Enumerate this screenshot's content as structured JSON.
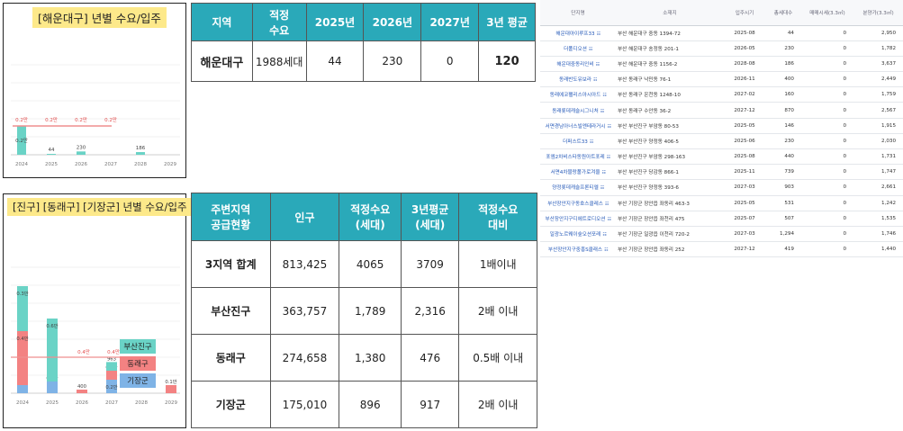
{
  "haeundae_panel": {
    "title": "[해운대구] 년별 수요/입주",
    "chart_data": {
      "type": "bar",
      "categories": [
        "2024",
        "2025",
        "2026",
        "2027",
        "2028",
        "2029"
      ],
      "series": [
        {
          "values": [
            0.2,
            0.0044,
            0.023,
            0,
            0.0186,
            0
          ],
          "labels": [
            "0.2만",
            "44",
            "230",
            "",
            "186",
            ""
          ]
        }
      ],
      "demand_line": {
        "value": 0.2,
        "labels": [
          "0.2만",
          "0.2만",
          "0.2만",
          "0.2만"
        ]
      },
      "colors": {
        "bar": "#6ad3c6",
        "line": "#ef8f8f",
        "label": "#e34c4c"
      }
    }
  },
  "haeundae_table": {
    "headers": [
      "지역",
      "적정\n수요",
      "2025년",
      "2026년",
      "2027년",
      "3년 평균"
    ],
    "row": [
      "해운대구",
      "1988세대",
      "44",
      "230",
      "0",
      "120"
    ]
  },
  "east_panel": {
    "title": "[진구] [동래구] [기장군] 년별 수요/입주",
    "chart_data": {
      "type": "bar",
      "categories": [
        "2024",
        "2025",
        "2026",
        "2027",
        "2028",
        "2029"
      ],
      "series": [
        {
          "name": "부산진구",
          "values": [
            0.5,
            0.7,
            0,
            0.0963,
            0,
            0
          ],
          "labels": [
            "0.3만",
            "0.6만",
            "",
            "963",
            "",
            ""
          ]
        },
        {
          "name": "동래구",
          "values": [
            0.6,
            0,
            0.04,
            0.1,
            0,
            0.09
          ],
          "labels": [
            "0.4만",
            "",
            "400",
            "0.1만",
            "",
            "0.1만"
          ]
        },
        {
          "name": "기장군",
          "values": [
            0.09,
            0.13,
            0,
            0.15,
            0,
            0
          ],
          "labels": [
            "371",
            "0.1만",
            "",
            "0.2만",
            "",
            ""
          ]
        }
      ],
      "demand_line": {
        "value": 0.4,
        "labels": [
          "0.4만",
          "0.4만"
        ]
      },
      "legend": [
        "부산진구",
        "동래구",
        "기장군"
      ],
      "colors": {
        "부산진구": "#6ad3c6",
        "동래구": "#f38282",
        "기장군": "#7fb3e6"
      }
    }
  },
  "supply_table": {
    "headers": [
      "주변지역\n공급현황",
      "인구",
      "적정수요\n(세대)",
      "3년평균\n(세대)",
      "적정수요\n대비"
    ],
    "rows": [
      [
        "3지역 합계",
        "813,425",
        "4065",
        "3709",
        "1배이내"
      ],
      [
        "부산진구",
        "363,757",
        "1,789",
        "2,316",
        "2배 이내"
      ],
      [
        "동래구",
        "274,658",
        "1,380",
        "476",
        "0.5배 이내"
      ],
      [
        "기장군",
        "175,010",
        "896",
        "917",
        "2배 이내"
      ]
    ]
  },
  "listing_table": {
    "headers": [
      "단지명",
      "소재지",
      "입주시기",
      "총세대수",
      "매매시세(3.3㎡)",
      "분양가(3.3㎡)"
    ],
    "rows": [
      [
        "해운대아이루프33",
        "부산 해운대구 중동 1394-72",
        "2025-08",
        "44",
        "0",
        "2,950"
      ],
      [
        "더폴디오션",
        "부산 해운대구 송정동 201-1",
        "2026-05",
        "230",
        "0",
        "1,782"
      ],
      [
        "해운대중동리인비",
        "부산 해운대구 중동 1156-2",
        "2028-08",
        "186",
        "0",
        "3,637"
      ],
      [
        "동래반도유보라",
        "부산 동래구 낙민동 76-1",
        "2026-11",
        "400",
        "0",
        "2,449"
      ],
      [
        "동래에코팰리스아시아드",
        "부산 동래구 온천동 1248-10",
        "2027-02",
        "160",
        "0",
        "1,759"
      ],
      [
        "동래롯데캐슬시그니처",
        "부산 동래구 수안동 36-2",
        "2027-12",
        "870",
        "0",
        "2,567"
      ],
      [
        "서면경남아너스빌엔테라거시",
        "부산 부산진구 부암동 80-53",
        "2025-05",
        "146",
        "0",
        "1,915"
      ],
      [
        "더퍼스트33",
        "부산 부산진구 양정동 406-5",
        "2025-06",
        "230",
        "0",
        "2,030"
      ],
      [
        "포엠2차비스타동원아트포레",
        "부산 부산진구 부암동 298-163",
        "2025-08",
        "440",
        "0",
        "1,731"
      ],
      [
        "서면4차블랑폴가로겨울",
        "부산 부산진구 당감동 866-1",
        "2025-11",
        "739",
        "0",
        "1,747"
      ],
      [
        "양정롯데캐슬프론티엘",
        "부산 부산진구 양정동 393-6",
        "2027-03",
        "903",
        "0",
        "2,661"
      ],
      [
        "부산장안지구동호스클레스",
        "부산 기장군 장안읍 좌동리 463-3",
        "2025-05",
        "531",
        "0",
        "1,242"
      ],
      [
        "부산장안지구디에트로디오션",
        "부산 기장군 장안읍 좌천리 475",
        "2025-07",
        "507",
        "0",
        "1,535"
      ],
      [
        "일광노르웨이숲오션포레",
        "부산 기장군 일광읍 이천리 720-2",
        "2027-03",
        "1,294",
        "0",
        "1,746"
      ],
      [
        "부산장안지구중흥S클래스",
        "부산 기장군 장안읍 좌동리 252",
        "2027-12",
        "419",
        "0",
        "1,440"
      ]
    ]
  }
}
